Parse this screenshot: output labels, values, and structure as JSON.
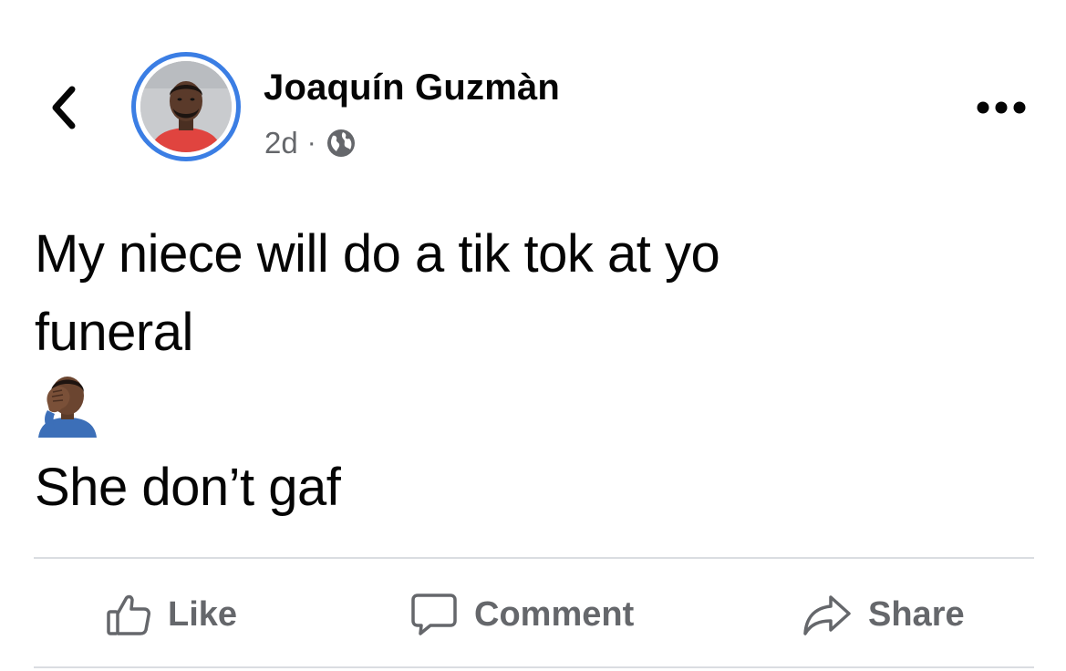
{
  "post": {
    "author_name": "Joaquín Guzmàn",
    "timestamp": "2d",
    "separator": "·",
    "audience_icon": "globe-icon",
    "text_lines": [
      "My niece will do a tik tok at yo",
      "funeral"
    ],
    "emoji_icon": "facepalm-emoji-icon",
    "text_after_emoji": "She don’t gaf"
  },
  "header": {
    "back_icon": "chevron-left-icon",
    "more_icon": "more-options-icon"
  },
  "actions": {
    "like_label": "Like",
    "comment_label": "Comment",
    "share_label": "Share"
  },
  "colors": {
    "avatar_ring": "#3b7ee4",
    "text_primary": "#050505",
    "text_secondary": "#65676b",
    "divider": "#dadde1"
  }
}
